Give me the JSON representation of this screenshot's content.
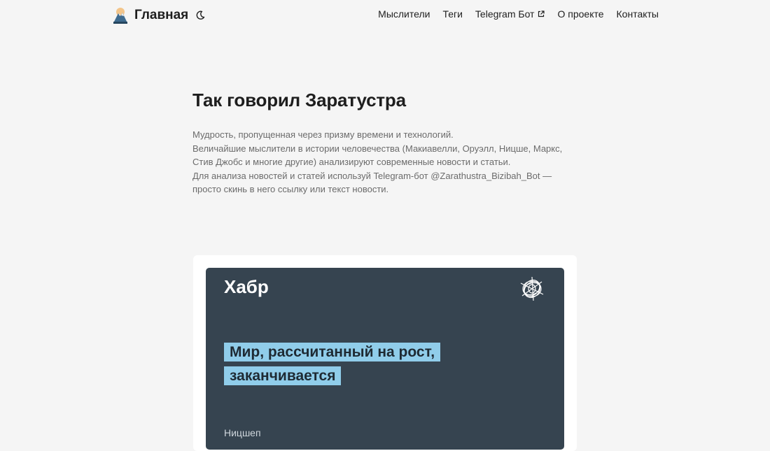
{
  "header": {
    "brand_title": "Главная",
    "nav": [
      {
        "label": "Мыслители",
        "external": false
      },
      {
        "label": "Теги",
        "external": false
      },
      {
        "label": "Telegram Бот",
        "external": true
      },
      {
        "label": "О проекте",
        "external": false
      },
      {
        "label": "Контакты",
        "external": false
      }
    ]
  },
  "hero": {
    "title": "Так говорил Заратустра",
    "lines": [
      "Мудрость, пропущенная через призму времени и технологий.",
      "Величайшие мыслители в истории человечества (Макиавелли, Оруэлл, Ницше, Маркс, Стив Джобс и многие другие) анализируют современные новости и статьи.",
      "Для анализа новостей и статей используй Telegram-бот @Zarathustra_Bizibah_Bot — просто скинь в него ссылку или текст новости."
    ]
  },
  "card": {
    "source_logo": "Хабр",
    "headline": "Мир, рассчитанный на рост, заканчивается",
    "author_partial": "Ницшеп"
  },
  "icons": {
    "logo": "mountain-logo-icon",
    "theme": "moon-icon",
    "external": "external-link-icon",
    "habr_mark": "scribble-ball-icon"
  },
  "colors": {
    "background": "#f5f5f5",
    "card_background": "#364450",
    "headline_highlight": "#90cdea"
  }
}
